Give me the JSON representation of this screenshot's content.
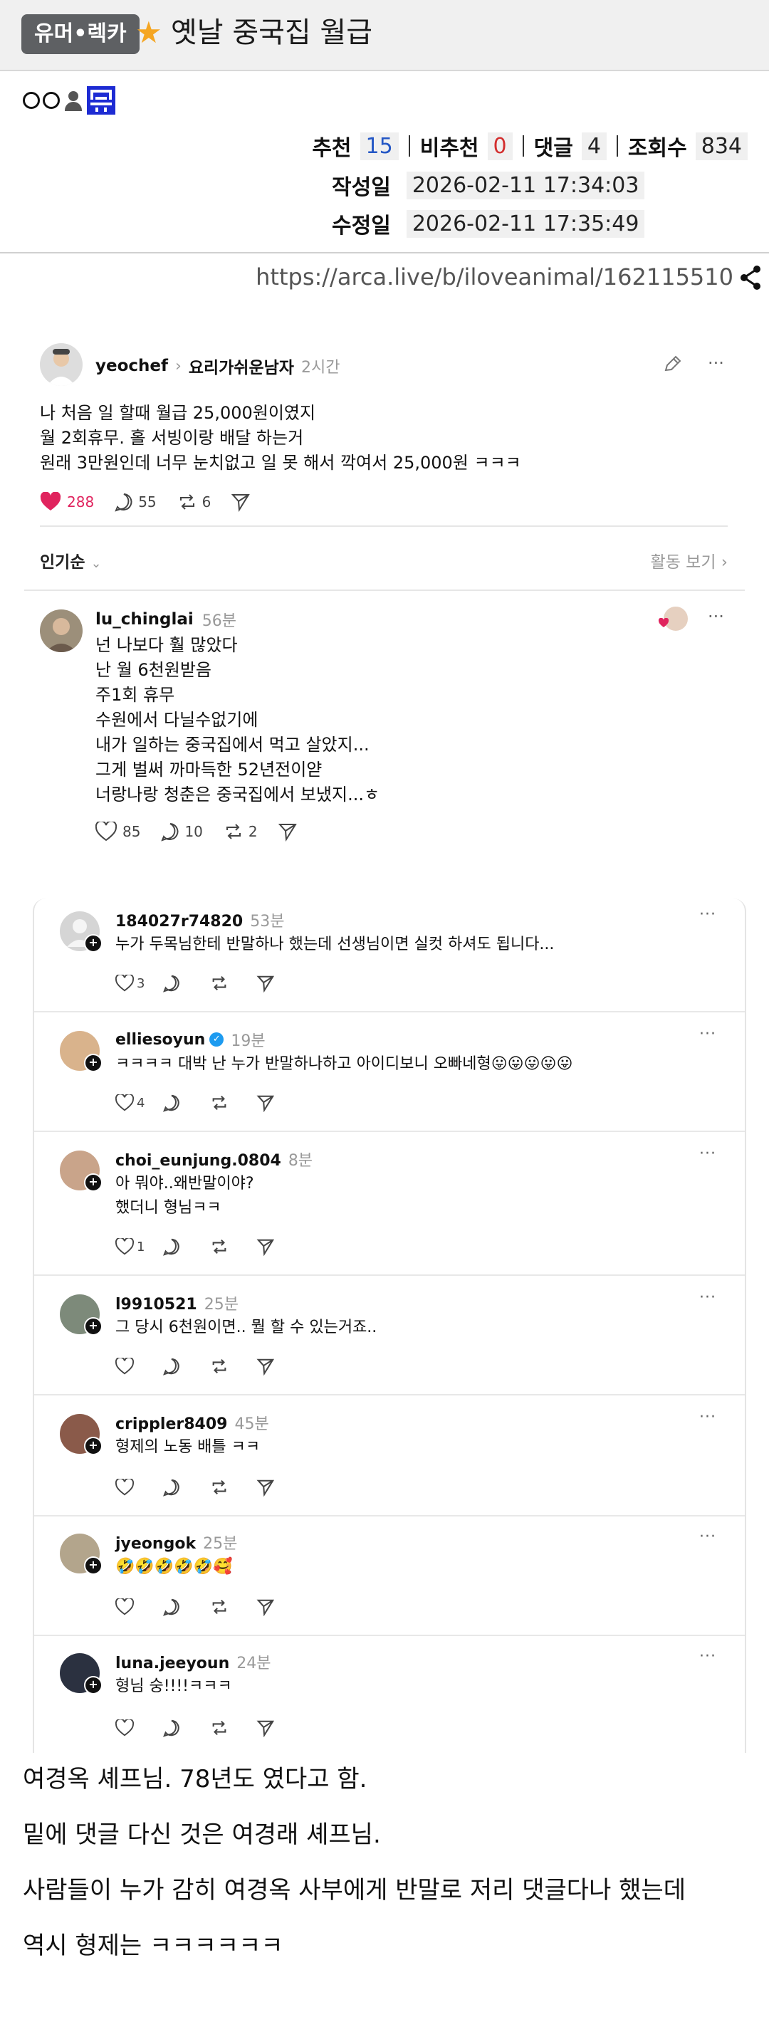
{
  "header": {
    "category": "유머•렉카",
    "title": "옛날 중국집 월급",
    "author_marks": "○○"
  },
  "stats": {
    "recommend_label": "추천",
    "recommend": "15",
    "unrecommend_label": "비추천",
    "unrecommend": "0",
    "comments_label": "댓글",
    "comments": "4",
    "views_label": "조회수",
    "views": "834",
    "created_label": "작성일",
    "created": "2026-02-11 17:34:03",
    "modified_label": "수정일",
    "modified": "2026-02-11 17:35:49"
  },
  "source_url": "https://arca.live/b/iloveanimal/162115510",
  "post": {
    "username": "yeochef",
    "topic": "요리가쉬운남자",
    "time": "2시간",
    "lines": [
      "나 처음 일 할때 월급 25,000원이였지",
      "월 2회휴무. 홀 서빙이랑 배달 하는거",
      "원래 3만원인데 너무 눈치없고 일 못 해서 깍여서 25,000원 ㅋㅋㅋ"
    ],
    "likes": "288",
    "replies": "55",
    "reposts": "6",
    "sort_label": "인기순",
    "activity_label": "활동 보기"
  },
  "top_reply": {
    "username": "lu_chinglai",
    "time": "56분",
    "lines": [
      "넌 나보다 훨 많았다",
      "난 월 6천원받음",
      "주1회 휴무",
      "수원에서 다닐수없기에",
      "내가 일하는 중국집에서 먹고 살았지...",
      "그게 벌써 까마득한 52년전이얃",
      "너랑나랑 청춘은 중국집에서 보냈지...ㅎ"
    ],
    "likes": "85",
    "replies": "10",
    "reposts": "2"
  },
  "replies": [
    {
      "username": "184027r74820",
      "time": "53분",
      "lines": [
        "누가 두목님한테 반말하나 했는데 선생님이면 실컷 하셔도 됩니다..."
      ],
      "likes": "3",
      "avatar": "#cfcfcf"
    },
    {
      "username": "elliesoyun",
      "time": "19분",
      "lines": [
        "ㅋㅋㅋㅋ 대박 난 누가 반말하나하고 아이디보니 오빠네형😛😛😛😛😛"
      ],
      "likes": "4",
      "avatar": "#d9b38c"
    },
    {
      "username": "choi_eunjung.0804",
      "time": "8분",
      "lines": [
        "아 뭐야..왜반말이야?",
        "했더니 형님ㅋㅋ"
      ],
      "likes": "1",
      "avatar": "#c9a48a"
    },
    {
      "username": "l9910521",
      "time": "25분",
      "lines": [
        "그 당시 6천원이면.. 뭘 할 수 있는거죠.."
      ],
      "likes": "",
      "avatar": "#7d8a7a"
    },
    {
      "username": "crippler8409",
      "time": "45분",
      "lines": [
        "형제의 노동 배틀 ㅋㅋ"
      ],
      "likes": "",
      "avatar": "#8a5a4a"
    },
    {
      "username": "jyeongok",
      "time": "25분",
      "lines": [
        "🤣🤣🤣🤣🤣🥰"
      ],
      "likes": "",
      "avatar": "#b3a58c"
    },
    {
      "username": "luna.jeeyoun",
      "time": "24분",
      "lines": [
        "형님 숭!!!!ㅋㅋㅋ"
      ],
      "likes": "",
      "avatar": "#2b3140"
    }
  ],
  "body_text": [
    "여경옥 셰프님. 78년도 였다고 함.",
    "밑에 댓글 다신 것은 여경래 셰프님.",
    "사람들이 누가 감히 여경옥 사부에게 반말로 저리 댓글다나 했는데",
    "역시 형제는 ㅋㅋㅋㅋㅋㅋ"
  ],
  "colors": {
    "heart": "#e0245e",
    "badge": "#1d2bd3",
    "verified": "#1d9bf0",
    "star": "#f5a623"
  }
}
